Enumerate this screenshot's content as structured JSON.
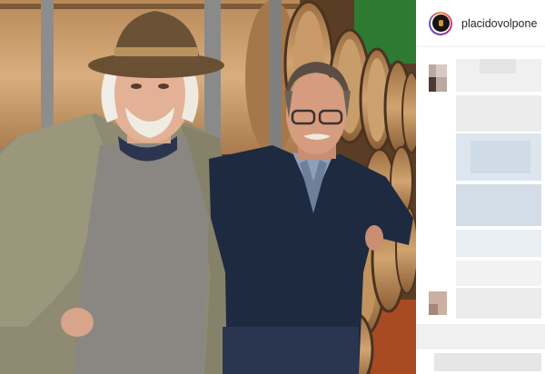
{
  "post": {
    "username": "placidovolpone",
    "photo_alt": "",
    "comments_obscured": true
  },
  "colors": {
    "username_text": "#262626",
    "sidebar_bg": "#ffffff",
    "avatar_ring": "#dd2a7b"
  },
  "icons": {
    "avatar": "profile-avatar-icon"
  }
}
